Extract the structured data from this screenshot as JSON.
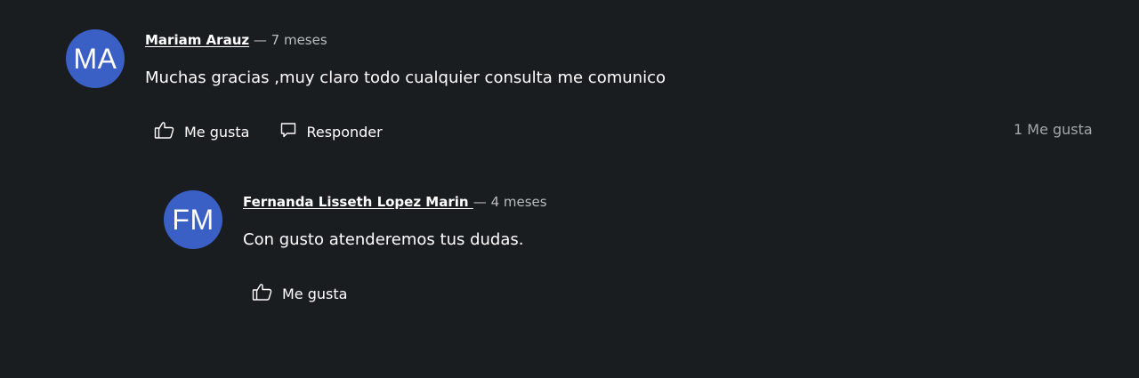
{
  "comments": [
    {
      "initials": "MA",
      "avatar_color": "#3a5fc5",
      "author": "Mariam Arauz",
      "time": "— 7 meses",
      "text": "Muchas gracias ,muy claro todo cualquier consulta me comunico",
      "like_label": "Me gusta",
      "reply_label": "Responder",
      "like_count": "1 Me gusta"
    }
  ],
  "replies": [
    {
      "initials": "FM",
      "avatar_color": "#3a5fc5",
      "author": "Fernanda Lisseth Lopez Marin ",
      "time": "— 4 meses",
      "text": "Con gusto atenderemos tus dudas.",
      "like_label": "Me gusta"
    }
  ]
}
